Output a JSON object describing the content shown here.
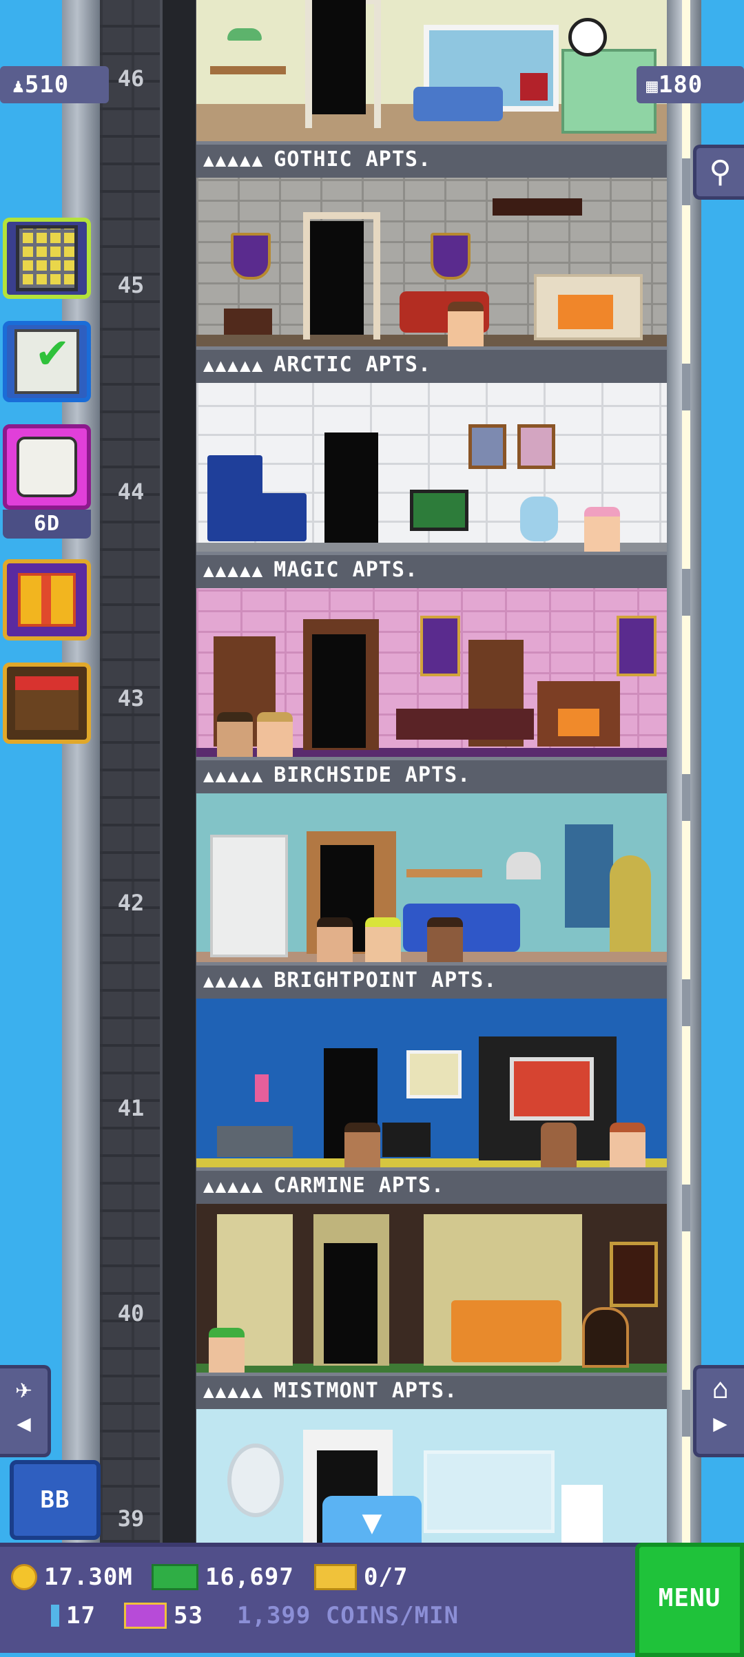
{
  "hud": {
    "population": "510",
    "floors_count": "180",
    "event_timer": "6D",
    "bb_label": "BB"
  },
  "floors": [
    {
      "number": "46",
      "name": "GOTHIC APTS.",
      "stars": "▲▲▲▲▲"
    },
    {
      "number": "45",
      "name": "ARCTIC APTS.",
      "stars": "▲▲▲▲▲"
    },
    {
      "number": "44",
      "name": "MAGIC APTS.",
      "stars": "▲▲▲▲▲"
    },
    {
      "number": "43",
      "name": "BIRCHSIDE APTS.",
      "stars": "▲▲▲▲▲"
    },
    {
      "number": "42",
      "name": "BRIGHTPOINT APTS.",
      "stars": "▲▲▲▲▲"
    },
    {
      "number": "41",
      "name": "CARMINE APTS.",
      "stars": "▲▲▲▲▲"
    },
    {
      "number": "40",
      "name": "MISTMONT APTS.",
      "stars": "▲▲▲▲▲"
    },
    {
      "number": "39",
      "name": "",
      "stars": ""
    }
  ],
  "bottom": {
    "coins": "17.30M",
    "bux": "16,697",
    "tickets": "0/7",
    "keys": "17",
    "vip": "53",
    "rate": "1,399 COINS/MIN",
    "menu_label": "MENU"
  },
  "colors": {
    "sky": "#3bb0ee",
    "hud_bar": "#514f8a",
    "menu_green": "#1fc23a",
    "banner": "#5a5f6b"
  }
}
